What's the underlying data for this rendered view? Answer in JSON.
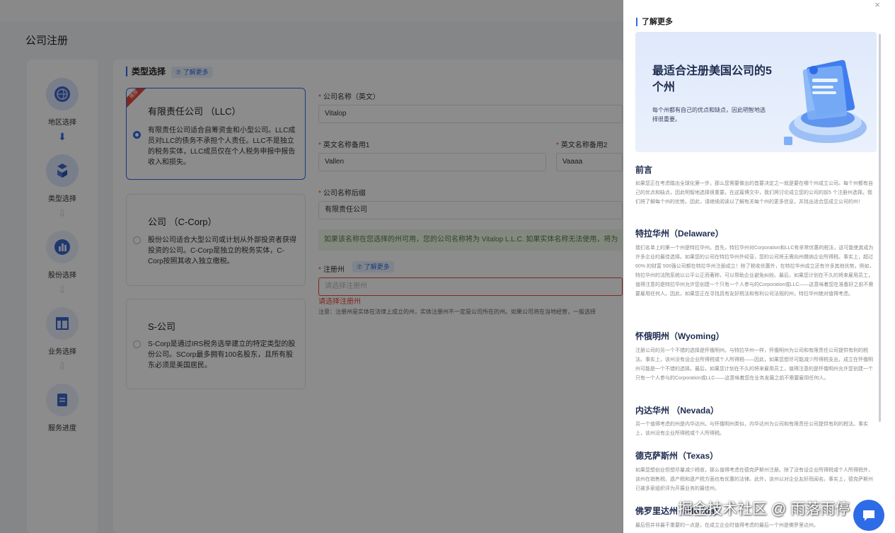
{
  "page": {
    "title": "公司注册"
  },
  "stepper": {
    "steps": [
      {
        "label": "地区选择",
        "icon": "globe-icon"
      },
      {
        "label": "类型选择",
        "icon": "cubes-icon"
      },
      {
        "label": "股份选择",
        "icon": "bar-chart-icon"
      },
      {
        "label": "业务选择",
        "icon": "layout-icon"
      },
      {
        "label": "服务进度",
        "icon": "document-icon"
      }
    ]
  },
  "type_section": {
    "title": "类型选择",
    "learn_more": "⑦ 了解更多",
    "cards": [
      {
        "badge": "推荐",
        "title": "有限责任公司 （LLC）",
        "desc": "有限责任公司适合自筹资金和小型公司。LLC成员对LLC的债务不承担个人责任。LLC不是独立的税务实体，LLC成员仅在个人税务申报中报告收入和损失。",
        "selected": true
      },
      {
        "title": "公司 （C-Corp）",
        "desc": "股份公司适合大型公司或计划从外部投资者获得投资的公司。C-Corp是独立的税务实体，C-Corp按照其收入独立缴税。",
        "selected": false
      },
      {
        "title": "S-公司",
        "desc": "S-Corp是通过IRS税务选举建立的特定类型的股份公司。SCorp最多拥有100名股东，且所有股东必须是美国居民。",
        "selected": false
      }
    ]
  },
  "form": {
    "name_en_label": "公司名称（英文）",
    "name_en_value": "Vitalop",
    "alt1_label": "英文名称备用1",
    "alt1_value": "Vallen",
    "alt2_label": "英文名称备用2",
    "alt2_value": "Vaaaa",
    "suffix_label": "公司名称后缀",
    "suffix_value": "有限责任公司",
    "hint": "如果该名称在您选择的州可用，您的公司名称将为 Vitalop L.L.C. 如果实体名称无法使用，将为",
    "state_label": "注册州",
    "state_learn_more": "⑦ 了解更多",
    "state_placeholder": "请选择注册州",
    "state_error": "请选择注册州",
    "state_note": "注意：注册州是实体在法律上成立的州，实体注册州不一定是公司所在的州。如果公司将在当地经营，一般选择"
  },
  "drawer": {
    "close": "×",
    "title": "了解更多",
    "banner_title": "最适合注册美国公司的5个州",
    "banner_sub": "每个州都有自己的优点和缺点，因此明智地选择很重要。",
    "sections": [
      {
        "heading": "前言",
        "body": "如果您正在考虑踏出全球化第一步，那么您需要做出的首要决定之一就是要在哪个州成立公司。每个州都有自己的优点和缺点，因此明智地选择很重要。在这篇博文中，我们将讨论成立您的公司的前5 个注册州选择。我们将了解每个州的优势。因此，请继续阅读以了解有关每个州的更多信息，并找出适合您成立公司的州！"
      },
      {
        "heading": "特拉华州（Delaware）",
        "body": "我们名单上的第一个州是特拉华州。首先，特拉华州对Corporation和LLC有非常优惠的税法，这可能使其成为许多企业的最佳选择。如果您的公司在特拉华州外经营，您的公司将无需向州缴纳企业所得税。事实上，超过60% 的财富 500强公司都在特拉华州注册成立！除了税收优惠外，在特拉华州成立还有许多其他优势。例如，特拉华州的法院系统以公平公正而著称，可以帮助企业避免纠纷。最后，如果您计划在不久的将来雇用员工，值得注意的是特拉华州允许您创建一个只有一个人参与的Corporation或LLC——这意味着您在准备好之前不需要雇用任何人。因此，如果您正在寻找具有友好税法和有利公司法规的州，特拉华州绝对值得考虑。"
      },
      {
        "heading": "怀俄明州（Wyoming）",
        "body": "注册公司的另一个不错的选择是怀俄明州。与特拉华州一样，怀俄明州为公司和有限责任公司提供有利的税法。事实上，该州没有设企业所得税或个人所得税——因此，如果您想尽可能减少所得税支出，成立在怀俄明州可能是一个不错的选择。最后，如果您计划在不久的将来雇用员工，值得注意的是怀俄明州允许您创建一个只有一个人参与的Corporation或LLC——这意味着您在业务发展之前不需要雇用任何人。"
      },
      {
        "heading": "内达华州 （Nevada）",
        "body": "另一个值得考虑的州是内华达州。与怀俄明州类似，内华达州为公司和有限责任公司提供有利的税法。事实上，该州没有企业所得税或个人所得税。"
      },
      {
        "heading": "德克萨斯州（Texas）",
        "body": "如果您想创业但想尽量减少税收，那么值得考虑在德克萨斯州注册。除了没有设企业所得税或个人所得税外，该州在销售税、遗产税和遗产税方面也有优惠的法律。此外，该州以对企业友好而闻名。事实上，德克萨斯州已被多家组织评为开展业务的最佳州。"
      },
      {
        "heading": "佛罗里达州（Florida）",
        "body": "最后但并非最不重要的一点是，在成立企业时值得考虑的最后一个州是佛罗里达州。"
      }
    ]
  },
  "watermark": "掘金技术社区 @ 雨落雨停",
  "colors": {
    "accent": "#2e6be6",
    "error": "#e8473b",
    "badge": "#e8473b"
  }
}
